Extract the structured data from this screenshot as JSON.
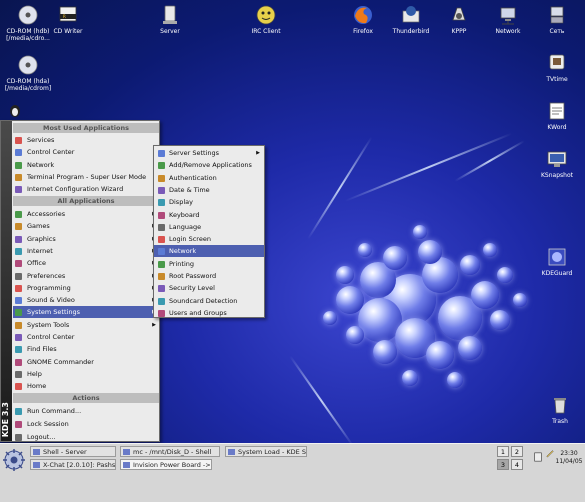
{
  "desktop": {
    "left_icons": [
      {
        "label": "CD-ROM (hdb)\n[/media/cdro...",
        "icon": "cdrom-icon"
      },
      {
        "label": "CD Writer",
        "icon": "cdwriter-icon"
      },
      {
        "label": "CD-ROM (hda)\n[/media/cdrom]",
        "icon": "cdrom-icon"
      }
    ],
    "top_icons": [
      "Server",
      "IRC Client",
      "Firefox",
      "Thunderbird",
      "KPPP",
      "Network",
      "Сеть"
    ],
    "right_icons": [
      "TVtime",
      "KWord",
      "KSnapshot",
      "KDEGuard",
      "Trash"
    ]
  },
  "menu": {
    "brand": "KDE 3.3",
    "section_most_used": "Most Used Applications",
    "most_used": [
      "Services",
      "Control Center",
      "Network",
      "Terminal Program - Super User Mode",
      "Internet Configuration Wizard"
    ],
    "section_all": "All Applications",
    "all_apps": [
      {
        "label": "Accessories",
        "sub": true
      },
      {
        "label": "Games",
        "sub": true
      },
      {
        "label": "Graphics",
        "sub": true
      },
      {
        "label": "Internet",
        "sub": true
      },
      {
        "label": "Office",
        "sub": true
      },
      {
        "label": "Preferences",
        "sub": true
      },
      {
        "label": "Programming",
        "sub": true
      },
      {
        "label": "Sound & Video",
        "sub": true
      },
      {
        "label": "System Settings",
        "sub": true,
        "selected": true
      },
      {
        "label": "System Tools",
        "sub": true
      },
      {
        "label": "Control Center",
        "sub": false
      },
      {
        "label": "Find Files",
        "sub": false
      },
      {
        "label": "GNOME Commander",
        "sub": false
      },
      {
        "label": "Help",
        "sub": false
      },
      {
        "label": "Home",
        "sub": false
      }
    ],
    "section_actions": "Actions",
    "actions": [
      "Run Command...",
      "Lock Session",
      "Logout..."
    ]
  },
  "submenu": {
    "items": [
      {
        "label": "Server Settings",
        "sub": true
      },
      {
        "label": "Add/Remove Applications",
        "sub": false
      },
      {
        "label": "Authentication",
        "sub": false
      },
      {
        "label": "Date & Time",
        "sub": false
      },
      {
        "label": "Display",
        "sub": false
      },
      {
        "label": "Keyboard",
        "sub": false
      },
      {
        "label": "Language",
        "sub": false
      },
      {
        "label": "Login Screen",
        "sub": false
      },
      {
        "label": "Network",
        "sub": false,
        "selected": true
      },
      {
        "label": "Printing",
        "sub": false
      },
      {
        "label": "Root Password",
        "sub": false
      },
      {
        "label": "Security Level",
        "sub": false
      },
      {
        "label": "Soundcard Detection",
        "sub": false
      },
      {
        "label": "Users and Groups",
        "sub": false
      }
    ]
  },
  "taskbar": {
    "tasks": [
      "Shell - Server",
      "mc - /mnt/Disk_D - Shell",
      "System Load - KDE Sy",
      "X-Chat [2.0.10]: Pashs @",
      "Invision Power Board ->"
    ],
    "pager": [
      "1",
      "2",
      "3",
      "4"
    ],
    "clock_time": "23:30",
    "clock_date": "11/04/05"
  },
  "colors": {
    "selection": "#4d5fb0",
    "menu_bg": "#ebebeb",
    "panel_bg": "#d6d6d6",
    "desktop_blue": "#1e2aa8"
  }
}
